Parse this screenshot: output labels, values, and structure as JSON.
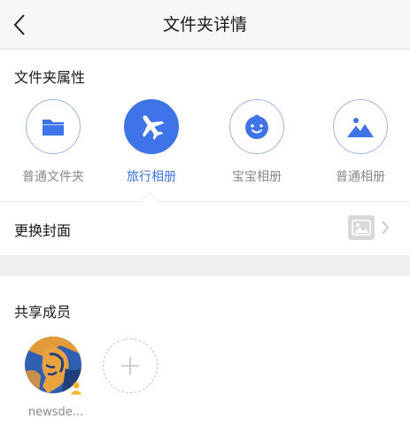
{
  "nav": {
    "title": "文件夹详情",
    "back_icon": "chevron-left-icon"
  },
  "properties": {
    "section_title": "文件夹属性",
    "selected": "旅行相册",
    "options": [
      {
        "label": "普通文件夹",
        "icon": "folder-icon",
        "active": false
      },
      {
        "label": "旅行相册",
        "icon": "airplane-icon",
        "active": true
      },
      {
        "label": "宝宝相册",
        "icon": "baby-face-icon",
        "active": false
      },
      {
        "label": "普通相册",
        "icon": "landscape-icon",
        "active": false
      }
    ]
  },
  "cover": {
    "label": "更换封面",
    "thumb_icon": "image-icon",
    "chevron_icon": "chevron-right-icon"
  },
  "members": {
    "section_title": "共享成员",
    "list": [
      {
        "name": "newsde...",
        "badge_icon": "owner-badge-icon"
      }
    ],
    "add_icon": "plus-icon"
  },
  "colors": {
    "accent": "#3f73e8",
    "muted_text": "#8a8a8a",
    "section_bg": "#f0f0f3"
  }
}
